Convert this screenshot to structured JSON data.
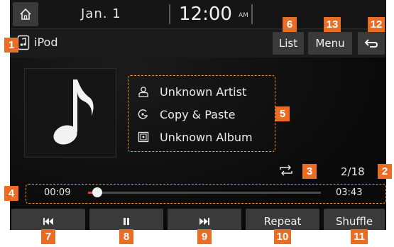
{
  "status_bar": {
    "date": "Jan.  1",
    "time": "12:00",
    "ampm": "AM",
    "home_icon": "home-icon"
  },
  "title_row": {
    "source_label": "iPod",
    "source_icon": "ipod-icon",
    "list_label": "List",
    "menu_label": "Menu",
    "back_icon": "back-arrow-icon"
  },
  "track_info": {
    "artist": "Unknown Artist",
    "title": "Copy & Paste",
    "album": "Unknown Album"
  },
  "playback": {
    "track_count": "2/18",
    "elapsed": "00:09",
    "total": "03:43",
    "progress_fraction": 0.04
  },
  "controls": {
    "prev_icon": "skip-previous-icon",
    "pause_icon": "pause-icon",
    "next_icon": "skip-next-icon",
    "repeat_label": "Repeat",
    "shuffle_label": "Shuffle"
  },
  "callouts": {
    "c1": "1",
    "c2": "2",
    "c3": "3",
    "c4": "4",
    "c5": "5",
    "c6": "6",
    "c7": "7",
    "c8": "8",
    "c9": "9",
    "c10": "10",
    "c11": "11",
    "c12": "12",
    "c13": "13"
  },
  "colors": {
    "callout": "#ea6d26",
    "progress_fill": "#e04a2b",
    "button_bg": "#3a3a3a"
  }
}
